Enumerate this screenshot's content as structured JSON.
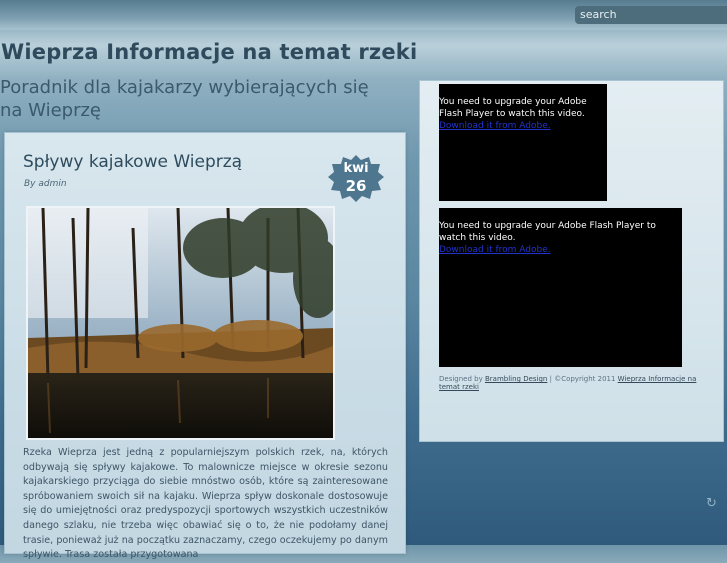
{
  "search": {
    "placeholder": "search"
  },
  "site": {
    "title": "Wieprza Informacje na temat rzeki",
    "tagline": "Poradnik dla kajakarzy wybierających się na Wieprzę"
  },
  "post": {
    "title": "Spływy kajakowe Wieprzą",
    "by_prefix": "By",
    "author": "admin",
    "date_month": "kwi",
    "date_day": "26",
    "image_alt": "Rzeka Wieprza w otoczeniu drzew",
    "text": "Rzeka Wieprza jest jedną z popularniejszym polskich rzek, na, których odbywają się spływy kajakowe. To malownicze miejsce w okresie sezonu kajakarskiego przyciąga do siebie mnóstwo osób, które są zainteresowane spróbowaniem swoich sił na kajaku. Wieprza spływ doskonale dostosowuje się do umiejętności oraz predyspozycji sportowych wszystkich uczestników danego szlaku, nie trzeba więc obawiać się o to, że nie podołamy danej trasie, ponieważ już na początku zaznaczamy, czego oczekujemy po danym spływie. Trasa została przygotowana"
  },
  "sidebar": {
    "flash1": {
      "message": "You need to upgrade your Adobe Flash Player to watch this video.",
      "link": "Download it from Adobe."
    },
    "flash2": {
      "message": "You need to upgrade your Adobe Flash Player to watch this video.",
      "link": "Download it from Adobe."
    },
    "footer": {
      "designed_by": "Designed by",
      "designer": "Brambling Design",
      "copyright": "| ©Copyright 2011",
      "site_link": "Wieprza Informacje na temat rzeki"
    }
  },
  "colors": {
    "accent": "#2e4a5c",
    "flash_bg": "#000000",
    "link": "#2233cc"
  },
  "icons": {
    "corner": "spinner-icon"
  }
}
